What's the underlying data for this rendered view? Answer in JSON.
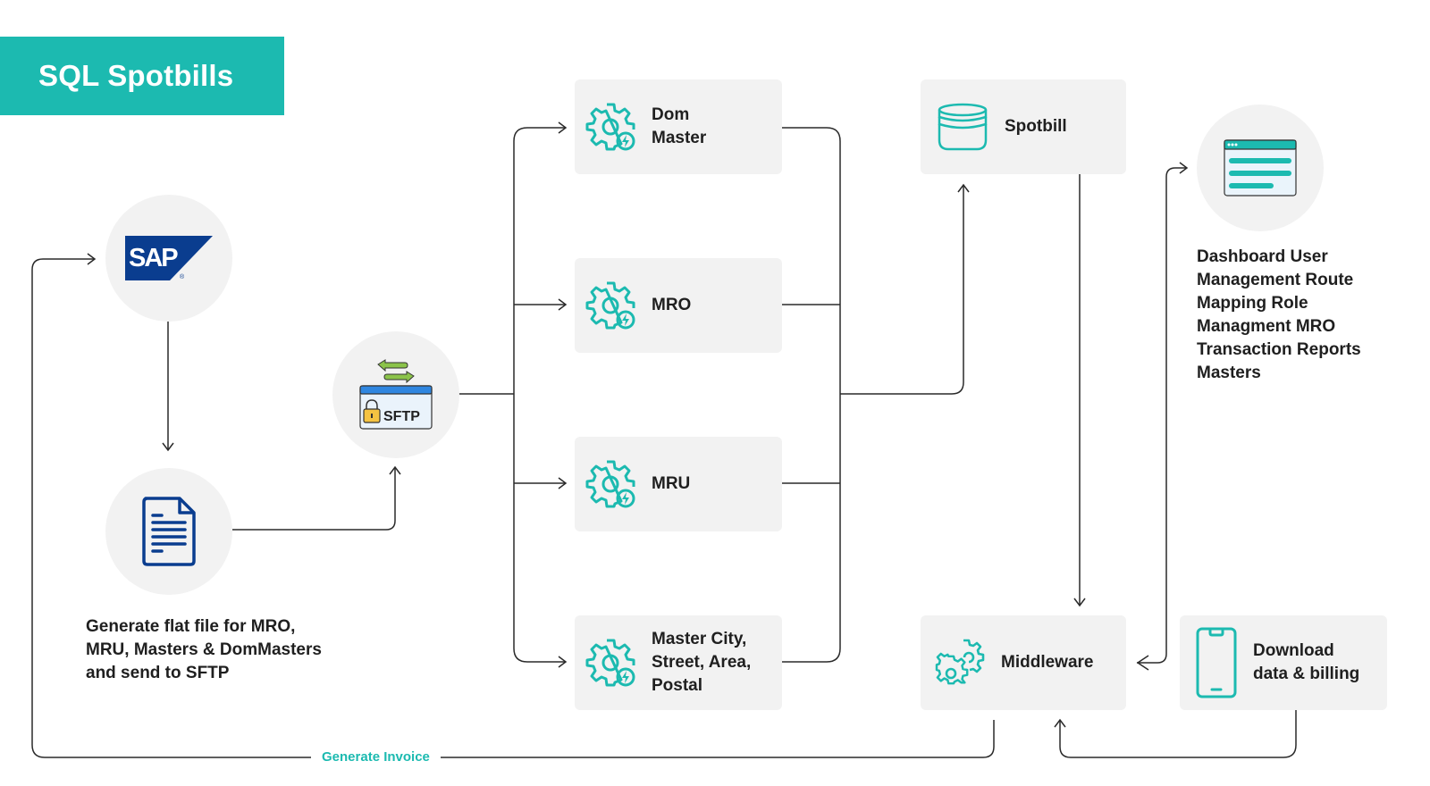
{
  "title": "SQL Spotbills",
  "colors": {
    "accent": "#1cbab0",
    "node_bg": "#f2f2f2",
    "sap_blue": "#0a3d8f",
    "line": "#2a2a2a"
  },
  "nodes": {
    "sap": {
      "label": "SAP",
      "icon": "sap-logo-icon"
    },
    "flat_file": {
      "icon": "document-icon",
      "caption": "Generate flat file for MRO, MRU, Masters & DomMasters and send to SFTP",
      "caption_lines": [
        "Generate flat file for MRO,",
        "MRU, Masters & DomMasters",
        "and send to SFTP"
      ]
    },
    "sftp": {
      "label": "SFTP",
      "icon": "sftp-transfer-icon"
    },
    "dom_master": {
      "label_lines": [
        "Dom",
        "Master"
      ],
      "icon": "gear-icon"
    },
    "mro": {
      "label": "MRO",
      "icon": "gear-icon"
    },
    "mru": {
      "label": "MRU",
      "icon": "gear-icon"
    },
    "master_city": {
      "label_lines": [
        "Master City,",
        "Street, Area,",
        "Postal"
      ],
      "icon": "gear-icon"
    },
    "spotbill": {
      "label": "Spotbill",
      "icon": "database-icon"
    },
    "middleware": {
      "label": "Middleware",
      "icon": "gears-icon"
    },
    "dashboard": {
      "icon": "browser-window-icon",
      "caption_lines": [
        "Dashboard User",
        "Management Route",
        "Mapping Role",
        "Managment MRO",
        "Transaction Reports",
        "Masters"
      ]
    },
    "download": {
      "label_lines": [
        "Download",
        "data & billing"
      ],
      "icon": "mobile-phone-icon"
    }
  },
  "edges": [
    {
      "from": "sap",
      "to": "flat_file"
    },
    {
      "from": "flat_file",
      "to": "sftp"
    },
    {
      "from": "sftp",
      "to": "dom_master"
    },
    {
      "from": "sftp",
      "to": "mro"
    },
    {
      "from": "sftp",
      "to": "mru"
    },
    {
      "from": "sftp",
      "to": "master_city"
    },
    {
      "from": "masters",
      "to": "spotbill"
    },
    {
      "from": "spotbill",
      "to": "middleware"
    },
    {
      "from": "middleware",
      "to": "dashboard"
    },
    {
      "from": "middleware",
      "to": "sap",
      "label": "Generate Invoice"
    },
    {
      "from": "download",
      "to": "middleware"
    }
  ],
  "edge_labels": {
    "generate_invoice": "Generate Invoice"
  }
}
